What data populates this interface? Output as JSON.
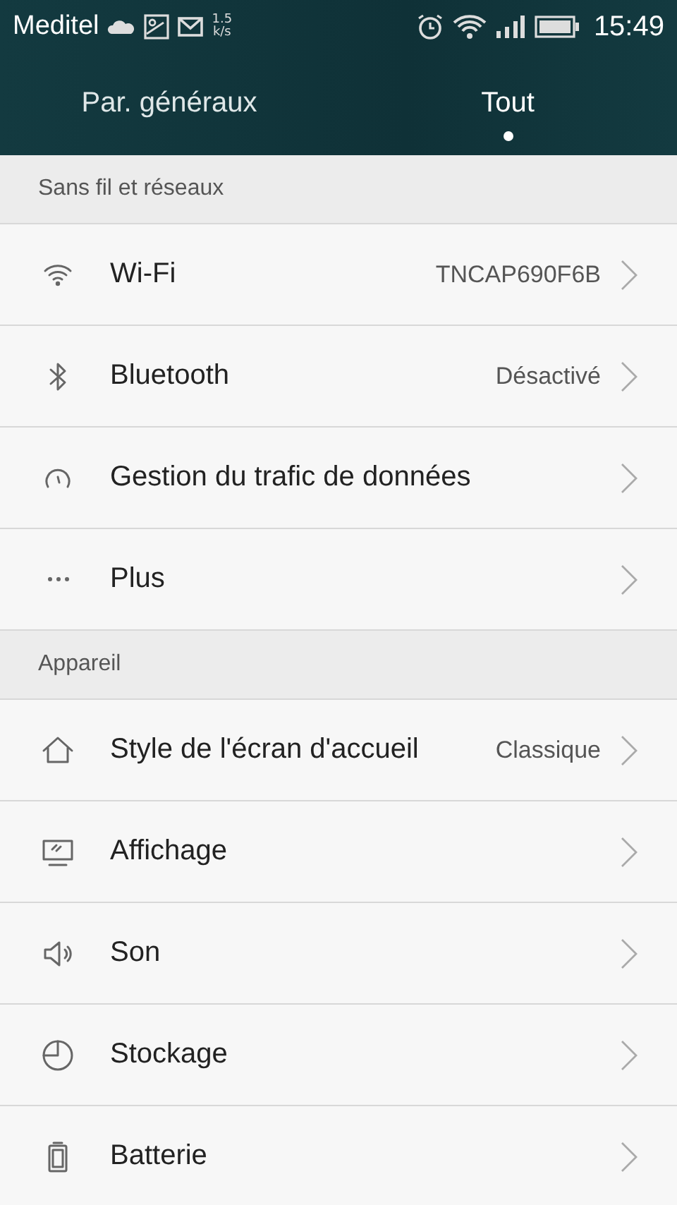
{
  "status_bar": {
    "carrier": "Meditel",
    "speed": "1.5",
    "speed_unit": "k/s",
    "time": "15:49"
  },
  "tabs": [
    {
      "label": "Par. généraux",
      "selected": false
    },
    {
      "label": "Tout",
      "selected": true
    }
  ],
  "sections": [
    {
      "title": "Sans fil et réseaux",
      "items": [
        {
          "label": "Wi-Fi",
          "value": "TNCAP690F6B"
        },
        {
          "label": "Bluetooth",
          "value": "Désactivé"
        },
        {
          "label": "Gestion du trafic de données"
        },
        {
          "label": "Plus"
        }
      ]
    },
    {
      "title": "Appareil",
      "items": [
        {
          "label": "Style de l'écran d'accueil",
          "value": "Classique"
        },
        {
          "label": "Affichage"
        },
        {
          "label": "Son"
        },
        {
          "label": "Stockage"
        },
        {
          "label": "Batterie"
        }
      ]
    }
  ]
}
